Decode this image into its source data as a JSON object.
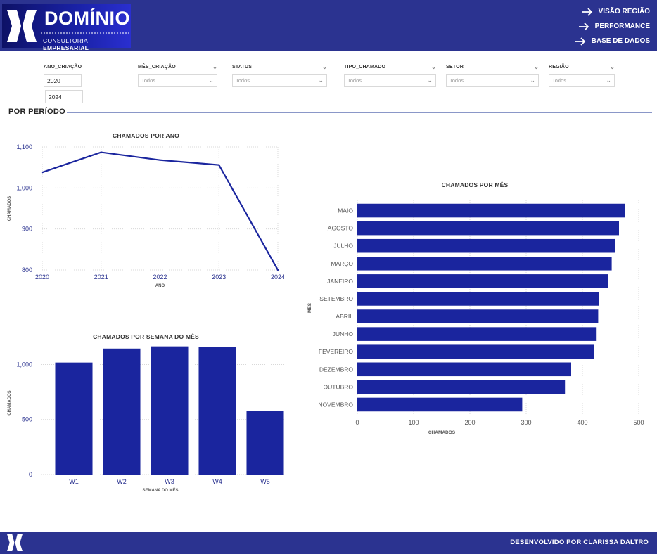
{
  "header": {
    "brand": "DOMÍNIO",
    "subtitle_plain": "CONSULTORIA ",
    "subtitle_bold": "EMPRESARIAL",
    "nav": [
      {
        "label": "VISÃO REGIÃO",
        "icon": "arrow-right-icon"
      },
      {
        "label": "PERFORMANCE",
        "icon": "arrow-right-icon"
      },
      {
        "label": "BASE DE DADOS",
        "icon": "arrow-right-icon"
      }
    ]
  },
  "filters": {
    "ano": {
      "label": "ANO_CRIAÇÃO",
      "from": "2020",
      "to": "2024"
    },
    "mes": {
      "label": "MÊS_CRIAÇÃO",
      "value": "Todos"
    },
    "status": {
      "label": "STATUS",
      "value": "Todos"
    },
    "tipo": {
      "label": "TIPO_CHAMADO",
      "value": "Todos"
    },
    "setor": {
      "label": "SETOR",
      "value": "Todos"
    },
    "regiao": {
      "label": "REGIÃO",
      "value": "Todos"
    }
  },
  "section": {
    "title": "POR PERÍODO"
  },
  "chart_data": [
    {
      "type": "line",
      "title": "CHAMADOS POR ANO",
      "xlabel": "ANO",
      "ylabel": "CHAMADOS",
      "x": [
        "2020",
        "2021",
        "2022",
        "2023",
        "2024"
      ],
      "values": [
        1038,
        1087,
        1068,
        1056,
        800
      ],
      "ylim": [
        800,
        1100
      ],
      "yticks": [
        800,
        900,
        1000,
        1100
      ],
      "ytick_labels": [
        "800",
        "900",
        "1,000",
        "1,100"
      ],
      "color": "#1a259e",
      "grid": true
    },
    {
      "type": "bar",
      "title": "CHAMADOS POR SEMANA DO MÊS",
      "xlabel": "SEMANA DO MÊS",
      "ylabel": "CHAMADOS",
      "categories": [
        "W1",
        "W2",
        "W3",
        "W4",
        "W5"
      ],
      "values": [
        1018,
        1145,
        1165,
        1157,
        578
      ],
      "ylim": [
        0,
        1150
      ],
      "yticks": [
        0,
        500,
        1000
      ],
      "ytick_labels": [
        "0",
        "500",
        "1,000"
      ],
      "color": "#1a259e",
      "grid": true
    },
    {
      "type": "bar",
      "orientation": "horizontal",
      "title": "CHAMADOS POR MÊS",
      "xlabel": "CHAMADOS",
      "ylabel": "MÊS",
      "categories": [
        "MAIO",
        "AGOSTO",
        "JULHO",
        "MARÇO",
        "JANEIRO",
        "SETEMBRO",
        "ABRIL",
        "JUNHO",
        "FEVEREIRO",
        "DEZEMBRO",
        "OUTUBRO",
        "NOVEMBRO"
      ],
      "values": [
        476,
        465,
        458,
        452,
        445,
        429,
        428,
        424,
        420,
        380,
        369,
        293
      ],
      "xlim": [
        0,
        500
      ],
      "xticks": [
        0,
        100,
        200,
        300,
        400,
        500
      ],
      "color": "#1a259e",
      "grid": true
    }
  ],
  "footer": {
    "credit": "DESENVOLVIDO POR CLARISSA DALTRO"
  }
}
